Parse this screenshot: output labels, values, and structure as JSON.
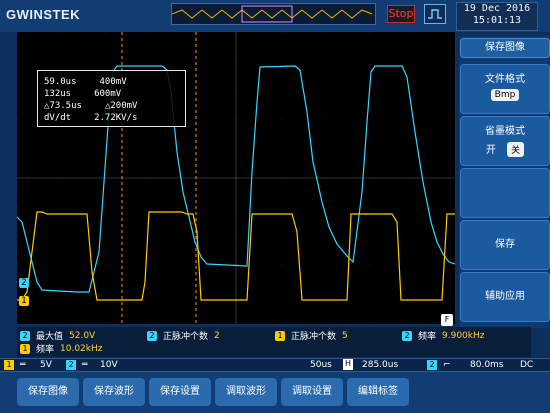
{
  "header": {
    "brand": "GWINSTEK",
    "run_state": "Stop",
    "date": "19 Dec 2016",
    "time": "15:01:13"
  },
  "cursor_readout": {
    "rows": [
      {
        "left": "59.0us",
        "right": "400mV"
      },
      {
        "left": "132us",
        "right": "600mV"
      },
      {
        "left": "△73.5us",
        "right": "△200mV"
      },
      {
        "left": "dV/dt",
        "right": "2.72KV/s"
      }
    ]
  },
  "softkeys": {
    "title": "保存图像",
    "file_format": {
      "label": "文件格式",
      "value": "Bmp"
    },
    "ink_saver": {
      "label": "省墨模式",
      "value_left": "开",
      "value_right": "关"
    },
    "save": "保存",
    "assist": "辅助应用"
  },
  "measurements": [
    {
      "badge": "2",
      "label": "最大值",
      "value": "52.0V"
    },
    {
      "badge": "2",
      "label": "正脉冲个数",
      "value": "2"
    },
    {
      "badge": "1",
      "label": "正脉冲个数",
      "value": "5"
    },
    {
      "badge": "2",
      "label": "频率",
      "value": "9.900kHz"
    },
    {
      "badge": "1",
      "label": "频率",
      "value": "10.02kHz"
    }
  ],
  "status": {
    "ch1": "5V",
    "ch2": "10V",
    "timebase": "50us",
    "horiz": "H",
    "position": "285.0us",
    "trigger": "80.0ms",
    "coupling": "DC",
    "f_label": "F"
  },
  "bottom_menu": [
    "保存图像",
    "保存波形",
    "保存设置",
    "调取波形",
    "调取设置",
    "编辑标签"
  ]
}
